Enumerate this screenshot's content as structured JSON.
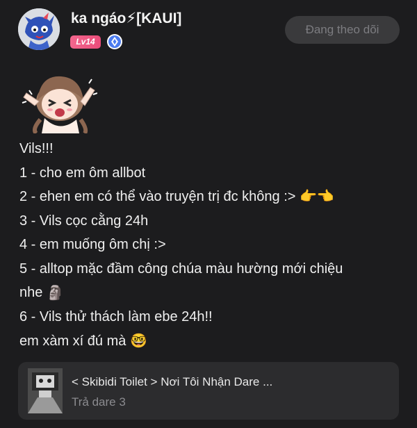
{
  "author": {
    "name": "ka ngáo⚡[KAUI]",
    "level": "Lv14",
    "verified_icon": "verified-diamond-icon",
    "follow_label": "Đang theo dõi"
  },
  "post": {
    "lines": [
      "Vils!!!",
      "1 - cho em ôm allbot",
      "2 - ehen em có thể vào truyện trị đc không :>",
      "3 - Vils cọc cằng 24h",
      "4 - em muống ôm chị :>",
      "5 - alltop mặc đầm công chúa màu hường mới chiệu",
      "nhe",
      "6 - Vils thử thách làm ebe 24h!!",
      "em xàm xí đú mà"
    ],
    "emojis": {
      "line2": "👉👈",
      "line6": "🗿",
      "line8": "🤓"
    }
  },
  "link_card": {
    "title": "< Skibidi Toilet > Nơi Tôi Nhận Dare ...",
    "subtitle": "Trả dare 3"
  },
  "colors": {
    "background": "#1c1c1e",
    "level_badge": "#ef5b85",
    "verified": "#4c7cf0",
    "card": "#2c2c2e"
  }
}
